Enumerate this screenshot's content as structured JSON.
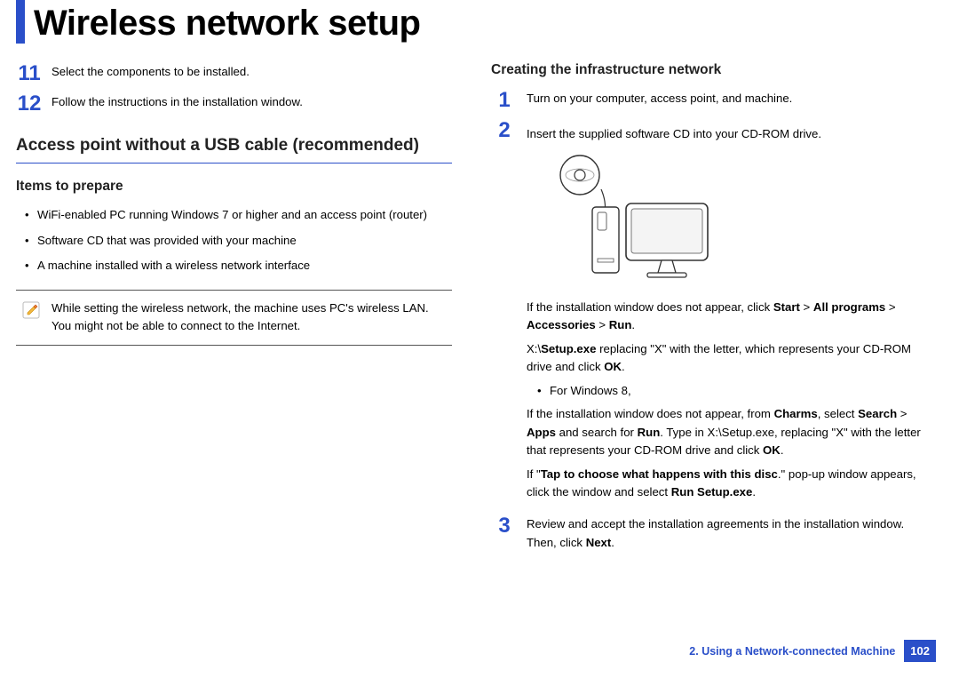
{
  "title": "Wireless network setup",
  "left": {
    "steps_cont": [
      {
        "num": "11",
        "text": "Select the components to be installed."
      },
      {
        "num": "12",
        "text": "Follow the instructions in the installation window."
      }
    ],
    "h2": "Access point without a USB cable (recommended)",
    "h3": "Items to prepare",
    "items": [
      "WiFi-enabled PC running Windows 7 or higher and an access point (router)",
      "Software CD that was provided with your machine",
      "A machine installed with a wireless network interface"
    ],
    "note": "While setting the wireless network, the machine uses PC's wireless LAN. You might not be able to connect to the Internet."
  },
  "right": {
    "h3": "Creating the infrastructure network",
    "step1": {
      "num": "1",
      "text": "Turn on your computer, access point, and machine."
    },
    "step2": {
      "num": "2",
      "intro": "Insert the supplied software CD into your CD-ROM drive.",
      "p1a": "If the installation window does not appear, click ",
      "p1b": "Start",
      "p1c": " > ",
      "p1d": "All programs",
      "p1e": " > ",
      "p1f": "Accessories",
      "p1g": " > ",
      "p1h": "Run",
      "p1i": ".",
      "p2a": "X:\\",
      "p2b": "Setup.exe",
      "p2c": " replacing \"X\" with the letter, which represents your CD-ROM drive and click ",
      "p2d": "OK",
      "p2e": ".",
      "win8_label": "For Windows 8,",
      "p3a": "If the installation window does not appear, from ",
      "p3b": "Charms",
      "p3c": ", select ",
      "p3d": "Search",
      "p3e": " > ",
      "p3f": "Apps",
      "p3g": " and search for ",
      "p3h": "Run",
      "p3i": ". Type in X:\\Setup.exe, replacing \"X\" with the letter that represents your CD-ROM drive and click ",
      "p3j": "OK",
      "p3k": ".",
      "p4a": "If \"",
      "p4b": "Tap to choose what happens with this disc",
      "p4c": ".\" pop-up window appears, click the window and select ",
      "p4d": "Run Setup.exe",
      "p4e": "."
    },
    "step3": {
      "num": "3",
      "a": "Review and accept the installation agreements in the installation window. Then, click ",
      "b": "Next",
      "c": "."
    }
  },
  "footer": {
    "chapter": "2.  Using a Network-connected Machine",
    "page": "102"
  }
}
